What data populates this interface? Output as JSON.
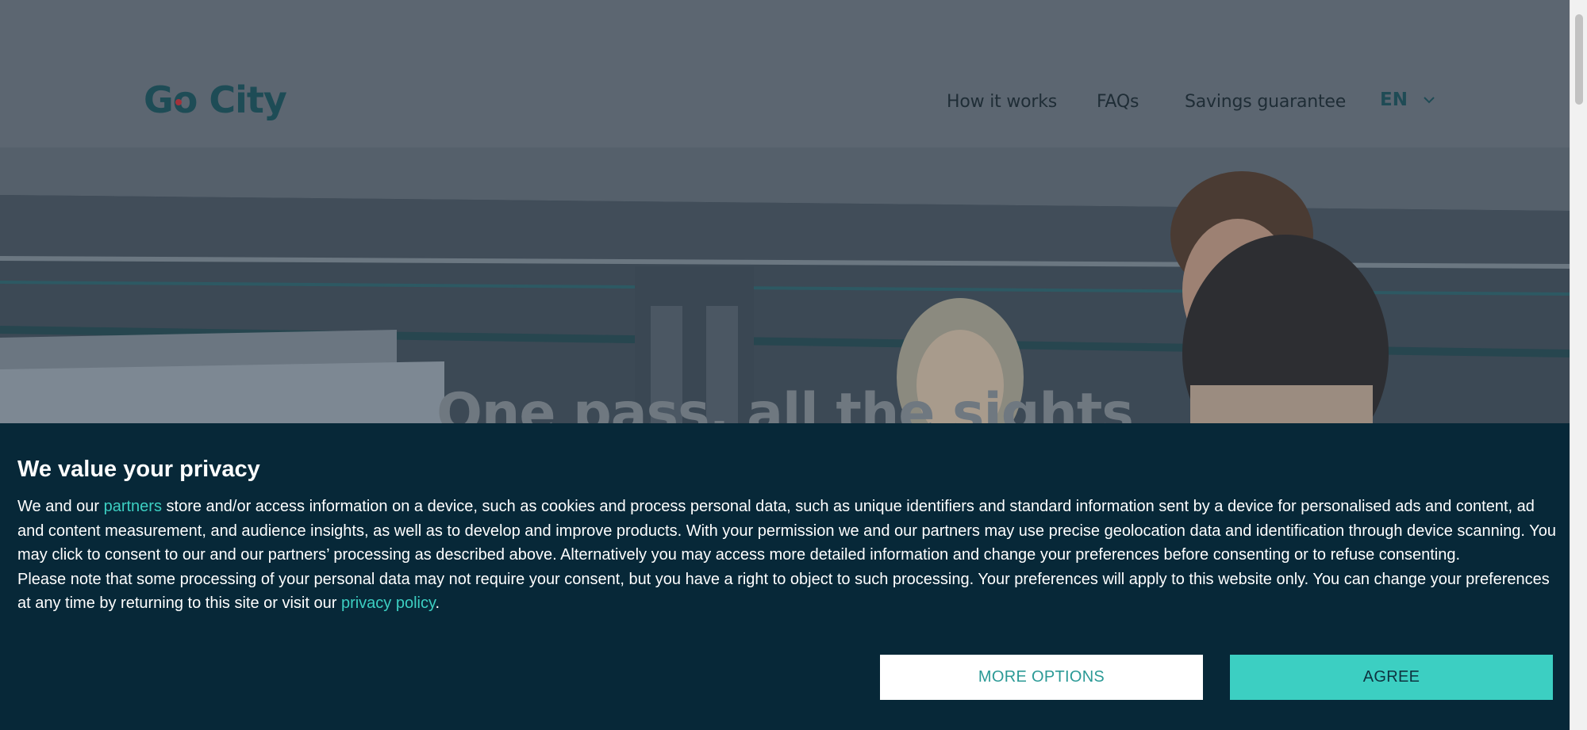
{
  "header": {
    "logo_text": "Go City",
    "nav": [
      {
        "label": "How it works"
      },
      {
        "label": "FAQs"
      },
      {
        "label": "Savings guarantee"
      }
    ],
    "language": {
      "value": "EN",
      "icon": "chevron-down-icon"
    }
  },
  "hero": {
    "title": "One pass, all the sights"
  },
  "cookie_banner": {
    "title": "We value your privacy",
    "p1_pre": "We and our ",
    "p1_link": "partners",
    "p1_post": " store and/or access information on a device, such as cookies and process personal data, such as unique identifiers and standard information sent by a device for personalised ads and content, ad and content measurement, and audience insights, as well as to develop and improve products. With your permission we and our partners may use precise geolocation data and identification through device scanning. You may click to consent to our and our partners’ processing as described above. Alternatively you may access more detailed information and change your preferences before consenting or to refuse consenting.",
    "p2_pre": "Please note that some processing of your personal data may not require your consent, but you have a right to object to such processing. Your preferences will apply to this website only. You can change your preferences at any time by returning to this site or visit our ",
    "p2_link": "privacy policy",
    "p2_post": ".",
    "more_options_label": "MORE OPTIONS",
    "agree_label": "AGREE"
  },
  "colors": {
    "banner_bg": "#072838",
    "accent": "#3ccfc2",
    "overlay": "#5c6671"
  }
}
